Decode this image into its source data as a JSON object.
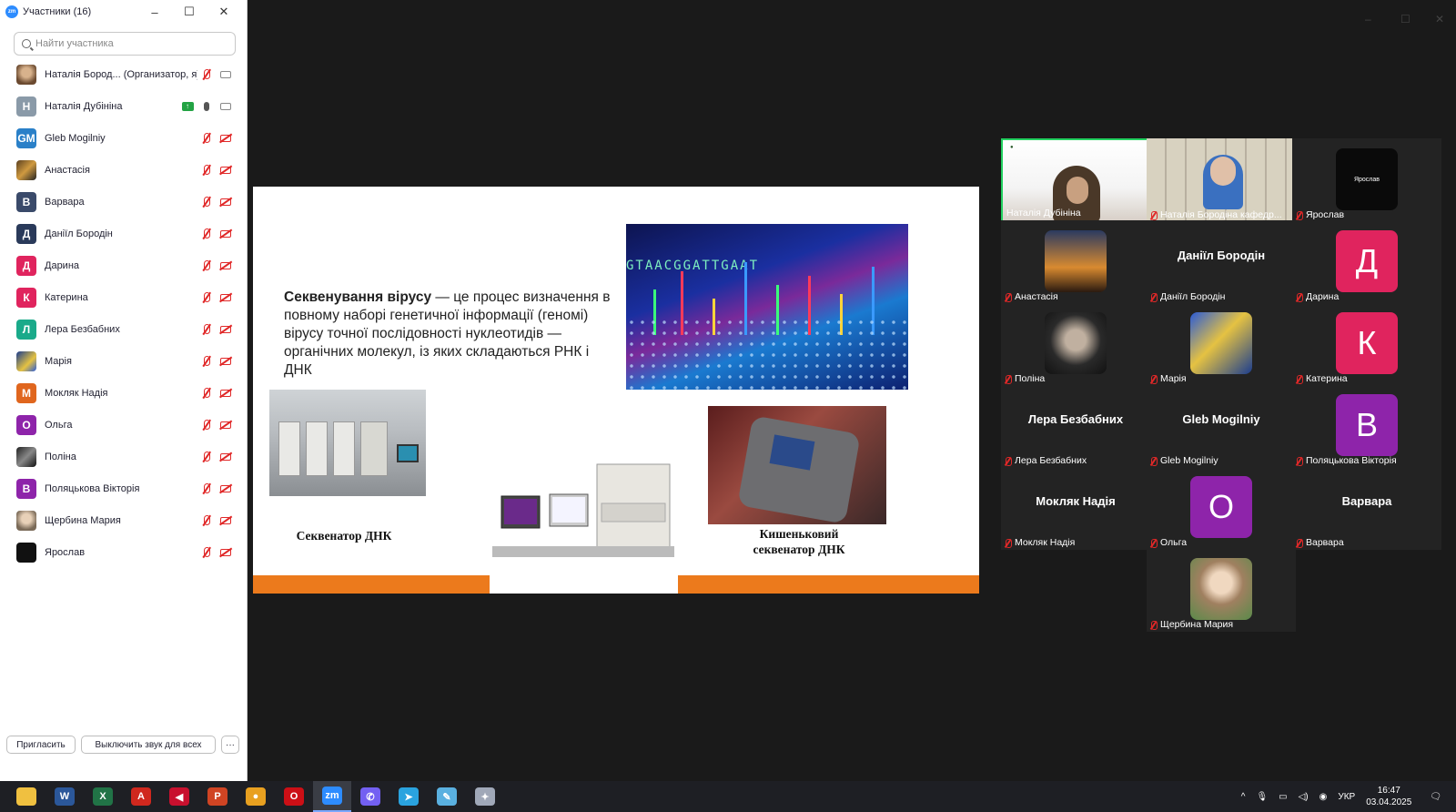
{
  "panel": {
    "title": "Участники (16)",
    "search_placeholder": "Найти участника",
    "participants": [
      {
        "name": "Наталія Бород... (Организатор, я)",
        "initial": "",
        "color": "",
        "mic": "muted",
        "cam": "on",
        "avatar": "photo"
      },
      {
        "name": "Наталія Дубініна",
        "initial": "Н",
        "color": "#8a9aa8",
        "mic": "on",
        "cam": "on",
        "share": true
      },
      {
        "name": "Gleb Mogilniy",
        "initial": "GM",
        "color": "#2a80c8",
        "mic": "muted",
        "cam": "off"
      },
      {
        "name": "Анастасія",
        "initial": "",
        "color": "",
        "mic": "muted",
        "cam": "off",
        "avatar": "photo2"
      },
      {
        "name": "Варвара",
        "initial": "В",
        "color": "#3a4a6a",
        "mic": "muted",
        "cam": "off"
      },
      {
        "name": "Даніїл Бородін",
        "initial": "Д",
        "color": "#2a3a5a",
        "mic": "muted",
        "cam": "off"
      },
      {
        "name": "Дарина",
        "initial": "Д",
        "color": "#e0245e",
        "mic": "muted",
        "cam": "off"
      },
      {
        "name": "Катерина",
        "initial": "К",
        "color": "#e0245e",
        "mic": "muted",
        "cam": "off"
      },
      {
        "name": "Лера Безбабних",
        "initial": "Л",
        "color": "#1aaa8a",
        "mic": "muted",
        "cam": "off"
      },
      {
        "name": "Марія",
        "initial": "",
        "color": "",
        "mic": "muted",
        "cam": "off",
        "avatar": "photo4"
      },
      {
        "name": "Мокляк Надія",
        "initial": "М",
        "color": "#e0661e",
        "mic": "muted",
        "cam": "off"
      },
      {
        "name": "Ольга",
        "initial": "О",
        "color": "#8e24aa",
        "mic": "muted",
        "cam": "off"
      },
      {
        "name": "Поліна",
        "initial": "",
        "color": "",
        "mic": "muted",
        "cam": "off",
        "avatar": "photo3"
      },
      {
        "name": "Поляцькова Вікторія",
        "initial": "В",
        "color": "#8e24aa",
        "mic": "muted",
        "cam": "off"
      },
      {
        "name": "Щербина Мария",
        "initial": "",
        "color": "",
        "mic": "muted",
        "cam": "off",
        "avatar": "photo5"
      },
      {
        "name": "Ярослав",
        "initial": "",
        "color": "",
        "mic": "muted",
        "cam": "off",
        "avatar": "dark"
      }
    ],
    "invite_label": "Пригласить",
    "mute_all_label": "Выключить звук для всех",
    "more_label": "···"
  },
  "slide": {
    "lead_bold": "Секвенування вірусу",
    "lead_rest": " — це процес визначення в повному наборі генетичної інформації (геномі) вірусу точної послідовності нуклеотидів — органічних молекул, із яких складаються РНК і ДНК",
    "dna_sequence": "GTAACGGATTGAAT",
    "caption_left": "Секвенатор ДНК",
    "caption_right_1": "Кишеньковий",
    "caption_right_2": "секвенатор ДНК"
  },
  "gallery": {
    "tiles": [
      {
        "name": "Наталія Дубініна",
        "kind": "video",
        "active": true,
        "muted": false
      },
      {
        "name": "Наталія Бородіна кафедр...",
        "kind": "video2",
        "muted": true
      },
      {
        "name": "Ярослав",
        "kind": "avatar-dark",
        "muted": true,
        "avatar_label": "Ярослав"
      },
      {
        "name": "Анастасія",
        "kind": "photo-sunset",
        "muted": true
      },
      {
        "name": "Даніїл Бородін",
        "kind": "text",
        "muted": true
      },
      {
        "name": "Дарина",
        "kind": "letter",
        "letter": "Д",
        "color": "#e0245e",
        "muted": true
      },
      {
        "name": "Поліна",
        "kind": "photo-girl",
        "muted": true
      },
      {
        "name": "Марія",
        "kind": "photo-art",
        "muted": true
      },
      {
        "name": "Катерина",
        "kind": "letter",
        "letter": "К",
        "color": "#e0245e",
        "muted": true
      },
      {
        "name": "Лера Безбабних",
        "kind": "text",
        "muted": true
      },
      {
        "name": "Gleb Mogilniy",
        "kind": "text",
        "muted": true
      },
      {
        "name": "Поляцькова Вікторія",
        "kind": "letter",
        "letter": "В",
        "color": "#8e24aa",
        "muted": true
      },
      {
        "name": "Мокляк Надія",
        "kind": "text",
        "muted": true
      },
      {
        "name": "Ольга",
        "kind": "letter",
        "letter": "О",
        "color": "#8e24aa",
        "muted": true
      },
      {
        "name": "Варвара",
        "kind": "text",
        "muted": true
      },
      {
        "name": "Щербина Мария",
        "kind": "photo-woman",
        "muted": true
      }
    ]
  },
  "taskbar": {
    "apps": [
      {
        "icon": "file-explorer-icon",
        "label": "",
        "color": "#f0c040"
      },
      {
        "icon": "word-icon",
        "label": "W",
        "color": "#2b579a"
      },
      {
        "icon": "excel-icon",
        "label": "X",
        "color": "#217346"
      },
      {
        "icon": "acrobat-icon",
        "label": "A",
        "color": "#d0281e"
      },
      {
        "icon": "anydesk-icon",
        "label": "◀",
        "color": "#c8102e"
      },
      {
        "icon": "powerpoint-icon",
        "label": "P",
        "color": "#d04423"
      },
      {
        "icon": "chrome-icon",
        "label": "●",
        "color": "#e8a020"
      },
      {
        "icon": "opera-icon",
        "label": "O",
        "color": "#cc0f16"
      },
      {
        "icon": "zoom-icon",
        "label": "zm",
        "color": "#2d8cff",
        "active": true
      },
      {
        "icon": "viber-icon",
        "label": "✆",
        "color": "#7360f2"
      },
      {
        "icon": "telegram-icon",
        "label": "➤",
        "color": "#2aa3df"
      },
      {
        "icon": "paint-icon",
        "label": "✎",
        "color": "#5ab0e0"
      },
      {
        "icon": "app-icon",
        "label": "✦",
        "color": "#a0a8b8"
      }
    ],
    "language": "УКР",
    "time": "16:47",
    "date": "03.04.2025"
  }
}
